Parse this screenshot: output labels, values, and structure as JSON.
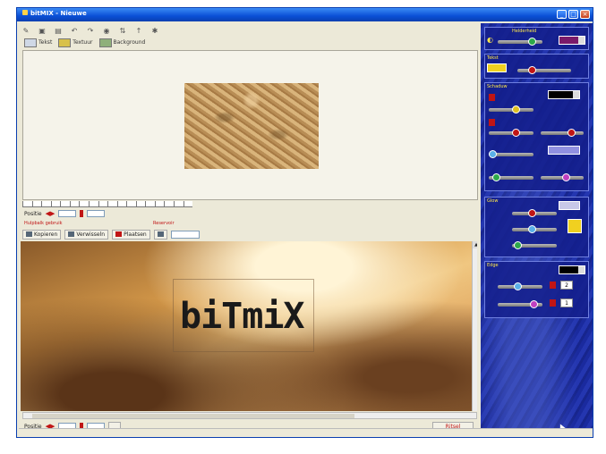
{
  "window": {
    "title": "bitMIX - Nieuwe",
    "buttons": [
      "_",
      "□",
      "×"
    ]
  },
  "toolbar": {
    "icons": [
      "new-icon",
      "open-icon",
      "save-icon",
      "undo-icon",
      "redo-icon",
      "zoom-icon",
      "insert-icon",
      "arrow-icon",
      "help-icon"
    ],
    "glyphs": [
      "✎",
      "▣",
      "▤",
      "↶",
      "↷",
      "◉",
      "⇅",
      "↑",
      "✱"
    ]
  },
  "tabs": [
    {
      "label": "Tekst"
    },
    {
      "label": "Textuur"
    },
    {
      "label": "Background"
    }
  ],
  "texture_controls": {
    "zoom_label": "Positie"
  },
  "sections": {
    "left": "Hulpbalk gebruik",
    "right": "Reservoir"
  },
  "buttons": {
    "row1": [
      "Kopieren",
      "Verwisseln",
      "Plaatsen"
    ]
  },
  "preview": {
    "logo_text": "biTmiX"
  },
  "bottom": {
    "zoom_label": "Positie",
    "finish_label": "Ritsel"
  },
  "panel": {
    "top_label": "Helderheid",
    "tekst_label": "Tekst",
    "bevel_label": "Schaduw",
    "section3_label": "Glow",
    "section4_label": "Edge",
    "values": {
      "a": "2",
      "b": "1"
    },
    "colors": {
      "top_swatch": "#7a1a6a",
      "tekst_swatch": "#f0d020",
      "bevel_swatch": "#000000",
      "glow_swatch": "#c8c8e8",
      "edge_swatch": "#000000",
      "gradient_swatch": "#9090e0"
    }
  }
}
